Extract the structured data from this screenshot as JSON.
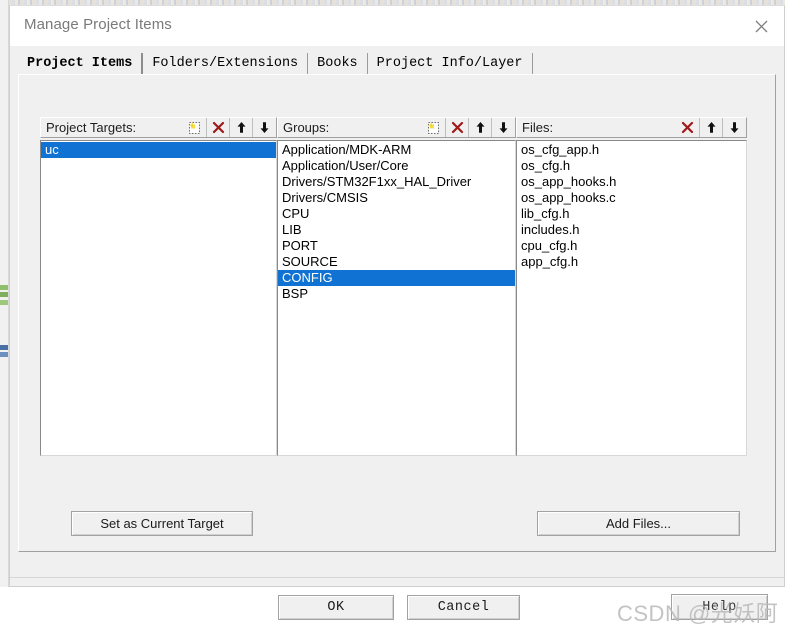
{
  "window": {
    "title": "Manage Project Items",
    "close_icon": "close-icon"
  },
  "tabs": [
    {
      "label": "Project Items",
      "active": true
    },
    {
      "label": "Folders/Extensions",
      "active": false
    },
    {
      "label": "Books",
      "active": false
    },
    {
      "label": "Project Info/Layer",
      "active": false
    }
  ],
  "panels": {
    "targets": {
      "label": "Project Targets:",
      "tools": [
        {
          "name": "new-item-icon",
          "title": "New (Insert)"
        },
        {
          "name": "delete-icon",
          "title": "Remove Item"
        },
        {
          "name": "move-up-icon",
          "title": "Move Up"
        },
        {
          "name": "move-down-icon",
          "title": "Move Down"
        }
      ],
      "items": [
        {
          "label": "uc",
          "selected": true
        }
      ]
    },
    "groups": {
      "label": "Groups:",
      "tools": [
        {
          "name": "new-item-icon",
          "title": "New (Insert)"
        },
        {
          "name": "delete-icon",
          "title": "Remove Item"
        },
        {
          "name": "move-up-icon",
          "title": "Move Up"
        },
        {
          "name": "move-down-icon",
          "title": "Move Down"
        }
      ],
      "items": [
        {
          "label": "Application/MDK-ARM",
          "selected": false
        },
        {
          "label": "Application/User/Core",
          "selected": false
        },
        {
          "label": "Drivers/STM32F1xx_HAL_Driver",
          "selected": false
        },
        {
          "label": "Drivers/CMSIS",
          "selected": false
        },
        {
          "label": "CPU",
          "selected": false
        },
        {
          "label": "LIB",
          "selected": false
        },
        {
          "label": "PORT",
          "selected": false
        },
        {
          "label": "SOURCE",
          "selected": false
        },
        {
          "label": "CONFIG",
          "selected": true
        },
        {
          "label": "BSP",
          "selected": false
        }
      ]
    },
    "files": {
      "label": "Files:",
      "tools": [
        {
          "name": "delete-icon",
          "title": "Remove Item"
        },
        {
          "name": "move-up-icon",
          "title": "Move Up"
        },
        {
          "name": "move-down-icon",
          "title": "Move Down"
        }
      ],
      "items": [
        {
          "label": "os_cfg_app.h",
          "selected": false
        },
        {
          "label": "os_cfg.h",
          "selected": false
        },
        {
          "label": "os_app_hooks.h",
          "selected": false
        },
        {
          "label": "os_app_hooks.c",
          "selected": false
        },
        {
          "label": "lib_cfg.h",
          "selected": false
        },
        {
          "label": "includes.h",
          "selected": false
        },
        {
          "label": "cpu_cfg.h",
          "selected": false
        },
        {
          "label": "app_cfg.h",
          "selected": false
        }
      ]
    }
  },
  "buttons": {
    "set_as_current_target": "Set as Current Target",
    "add_files": "Add Files...",
    "ok": "OK",
    "cancel": "Cancel",
    "help": "Help"
  },
  "watermark": {
    "text": "CSDN @光妖阿"
  },
  "colors": {
    "selection_blue": "#1072d2",
    "delete_red": "#9e1b1b",
    "new_icon_yellow": "#f5e04a",
    "dialog_face": "#f0f0f0",
    "listbox_white": "#ffffff",
    "title_text": "#7a7a7a"
  }
}
